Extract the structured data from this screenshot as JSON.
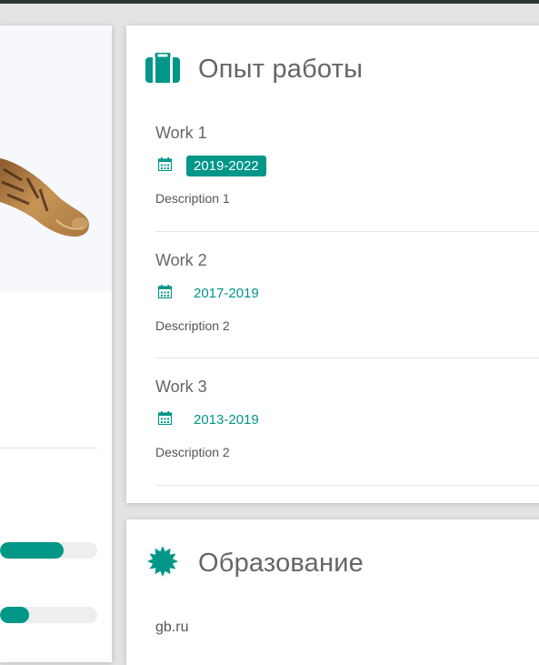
{
  "work": {
    "title": "Опыт работы",
    "entries": [
      {
        "title": "Work 1",
        "date": "2019-2022",
        "description": "Description 1",
        "current": true
      },
      {
        "title": "Work 2",
        "date": "2017-2019",
        "description": "Description 2",
        "current": false
      },
      {
        "title": "Work 3",
        "date": "2013-2019",
        "description": "Description 2",
        "current": false
      }
    ]
  },
  "education": {
    "title": "Образование",
    "items": [
      "gb.ru"
    ]
  },
  "skills": {
    "levels": [
      0.65,
      0.3
    ]
  },
  "icons": {
    "work": "briefcase-icon",
    "education": "certificate-icon",
    "date": "calendar-icon"
  },
  "colors": {
    "accent": "#009688",
    "text": "#666666",
    "background": "#e3e3e3",
    "card": "#ffffff",
    "topbar": "#2d3436"
  }
}
